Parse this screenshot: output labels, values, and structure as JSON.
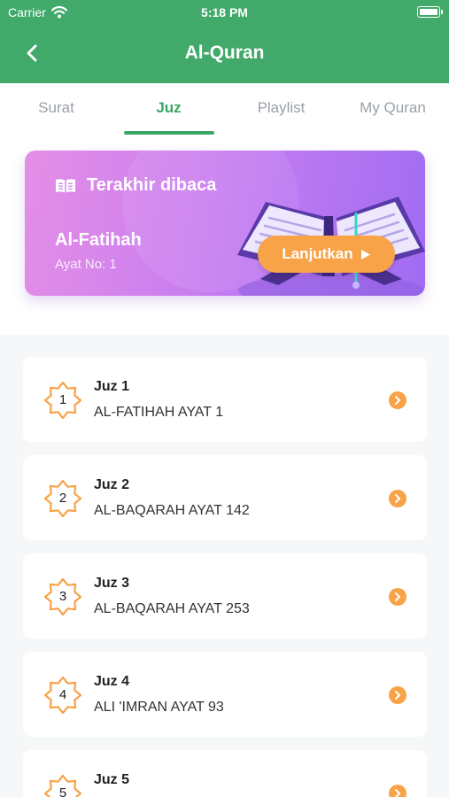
{
  "status": {
    "carrier": "Carrier",
    "time": "5:18 PM"
  },
  "header": {
    "title": "Al-Quran"
  },
  "tabs": [
    {
      "label": "Surat"
    },
    {
      "label": "Juz"
    },
    {
      "label": "Playlist"
    },
    {
      "label": "My Quran"
    }
  ],
  "active_tab": "Juz",
  "last_read": {
    "heading": "Terakhir dibaca",
    "surah": "Al-Fatihah",
    "ayat": "Ayat No: 1",
    "button": "Lanjutkan"
  },
  "juz": [
    {
      "number": "1",
      "title": "Juz 1",
      "start": "AL-FATIHAH AYAT 1"
    },
    {
      "number": "2",
      "title": "Juz 2",
      "start": "AL-BAQARAH AYAT 142"
    },
    {
      "number": "3",
      "title": "Juz 3",
      "start": "AL-BAQARAH AYAT 253"
    },
    {
      "number": "4",
      "title": "Juz 4",
      "start": "ALI 'IMRAN AYAT 93"
    },
    {
      "number": "5",
      "title": "Juz 5",
      "start": ""
    }
  ],
  "colors": {
    "primary": "#41a96a",
    "accent": "#f8a348",
    "banner": "#c97ef0"
  },
  "icons": {
    "back": "chevron-left-icon",
    "book": "open-book-icon",
    "play": "play-icon",
    "badge": "star-badge-icon",
    "go": "chevron-right-circle-icon"
  }
}
